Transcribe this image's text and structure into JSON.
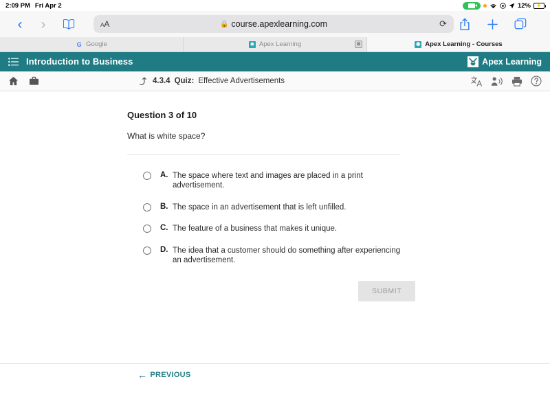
{
  "statusbar": {
    "time": "2:09 PM",
    "date": "Fri Apr 2",
    "battery_percent": "12%",
    "icons": [
      "screen-recording-pill",
      "orange-privacy-dot",
      "wifi-icon",
      "do-not-disturb-icon",
      "location-arrow-icon",
      "battery-charging-icon"
    ]
  },
  "browser": {
    "back_label": "‹",
    "forward_label": "›",
    "bookmarks_icon": "book-icon",
    "text_size_small": "A",
    "text_size_large": "A",
    "lock_icon": "🔒",
    "url": "course.apexlearning.com",
    "reload_icon": "⟳",
    "share_icon": "share-icon",
    "new_tab_icon": "+",
    "tabs_icon": "tabs-icon",
    "tabs": [
      {
        "title": "Google",
        "favicon": "google-icon",
        "active": false,
        "closable": false
      },
      {
        "title": "Apex Learning",
        "favicon": "apex-icon",
        "active": false,
        "closable": true,
        "close_label": "⊠"
      },
      {
        "title": "Apex Learning - Courses",
        "favicon": "apex-icon",
        "active": true,
        "closable": false
      }
    ]
  },
  "apex_header": {
    "menu_icon": "list-menu-icon",
    "course_title": "Introduction to Business",
    "logo_mark": "🐝",
    "logo_text": "Apex Learning",
    "teal": "#1f7c85"
  },
  "apex_toolbar": {
    "home_icon": "home-icon",
    "briefcase_icon": "briefcase-icon",
    "up_icon": "↰",
    "lesson_number": "4.3.4",
    "activity_type": "Quiz:",
    "activity_name": "Effective Advertisements",
    "translate_icon": "translate-icon",
    "read_aloud_icon": "read-aloud-icon",
    "print_icon": "print-icon",
    "help_icon": "help-icon"
  },
  "question": {
    "heading": "Question 3 of 10",
    "prompt": "What is white space?",
    "options": [
      {
        "letter": "A.",
        "text": "The space where text and images are placed in a print advertisement."
      },
      {
        "letter": "B.",
        "text": "The space in an advertisement that is left unfilled."
      },
      {
        "letter": "C.",
        "text": "The feature of a business that makes it unique."
      },
      {
        "letter": "D.",
        "text": "The idea that a customer should do something after experiencing an advertisement."
      }
    ],
    "submit_label": "SUBMIT",
    "submit_enabled": false
  },
  "footer": {
    "previous_arrow": "←",
    "previous_label": "PREVIOUS"
  }
}
